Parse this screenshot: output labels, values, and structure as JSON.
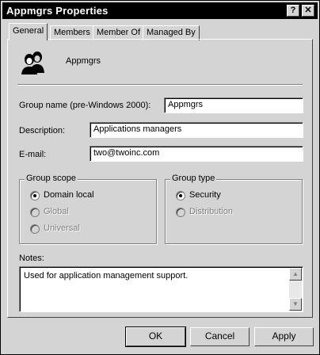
{
  "window": {
    "title": "Appmgrs Properties",
    "help_button": "?",
    "close_button": "✕"
  },
  "tabs": [
    {
      "label": "General",
      "active": true
    },
    {
      "label": "Members",
      "active": false
    },
    {
      "label": "Member Of",
      "active": false
    },
    {
      "label": "Managed By",
      "active": false
    }
  ],
  "general": {
    "group_icon": "group-users-icon",
    "group_display_name": "Appmgrs",
    "fields": {
      "group_name_label": "Group name (pre-Windows 2000):",
      "group_name_value": "Appmgrs",
      "description_label": "Description:",
      "description_value": "Applications managers",
      "email_label": "E-mail:",
      "email_value": "two@twoinc.com"
    },
    "group_scope": {
      "title": "Group scope",
      "options": [
        {
          "label": "Domain local",
          "selected": true,
          "enabled": true
        },
        {
          "label": "Global",
          "selected": false,
          "enabled": false
        },
        {
          "label": "Universal",
          "selected": false,
          "enabled": false
        }
      ]
    },
    "group_type": {
      "title": "Group type",
      "options": [
        {
          "label": "Security",
          "selected": true,
          "enabled": true
        },
        {
          "label": "Distribution",
          "selected": false,
          "enabled": false
        }
      ]
    },
    "notes": {
      "label": "Notes:",
      "value": "Used for application management support."
    }
  },
  "buttons": {
    "ok": "OK",
    "cancel": "Cancel",
    "apply": "Apply"
  }
}
